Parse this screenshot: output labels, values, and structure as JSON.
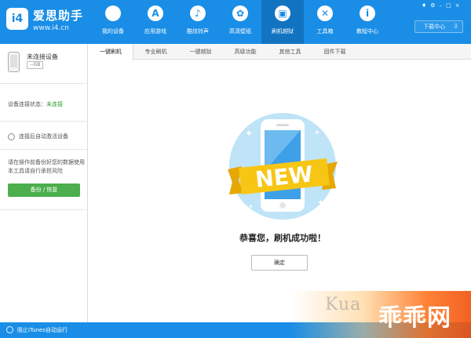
{
  "header": {
    "logo_text": "i4",
    "brand": "爱思助手",
    "site": "www.i4.cn",
    "nav": [
      {
        "label": "我的设备",
        "icon": "apple-icon",
        "glyph": ""
      },
      {
        "label": "应用游戏",
        "icon": "app-store-icon",
        "glyph": "A"
      },
      {
        "label": "酷炫铃声",
        "icon": "bell-icon",
        "glyph": "♪"
      },
      {
        "label": "高清壁纸",
        "icon": "wallpaper-icon",
        "glyph": "✿"
      },
      {
        "label": "刷机越狱",
        "icon": "box-icon",
        "glyph": "▣"
      },
      {
        "label": "工具箱",
        "icon": "tools-icon",
        "glyph": "✕"
      },
      {
        "label": "教程中心",
        "icon": "info-icon",
        "glyph": "i"
      }
    ],
    "download_label": "下载中心",
    "download_glyph": "⇩",
    "window_controls": [
      "♦",
      "⚙",
      "–",
      "□",
      "×"
    ]
  },
  "sidebar": {
    "device_name": "未连接设备",
    "capacity": "--GB",
    "conn_label": "设备连接状态：",
    "conn_value": "未连接",
    "auto_activate": "连接后自动激活设备",
    "backup_tip": "请在操作前备份好您的数据使用本工具请自行承担风险",
    "backup_button": "备份 / 恢复"
  },
  "tabs": [
    "一键刷机",
    "专业刷机",
    "一键越狱",
    "高级功能",
    "其他工具",
    "固件下载"
  ],
  "main": {
    "badge_text": "NEW",
    "success_text": "恭喜您，刷机成功啦！",
    "confirm_button": "确定"
  },
  "statusbar": {
    "itunes_text": "阻止iTunes自动运行"
  },
  "watermark": {
    "latin": "Kua",
    "cjk": "乖乖网"
  },
  "colors": {
    "header": "#1a8ee6",
    "nav_active": "#1273c1",
    "backup_button": "#4cae4c",
    "status_connected": "#2e9e2e"
  }
}
